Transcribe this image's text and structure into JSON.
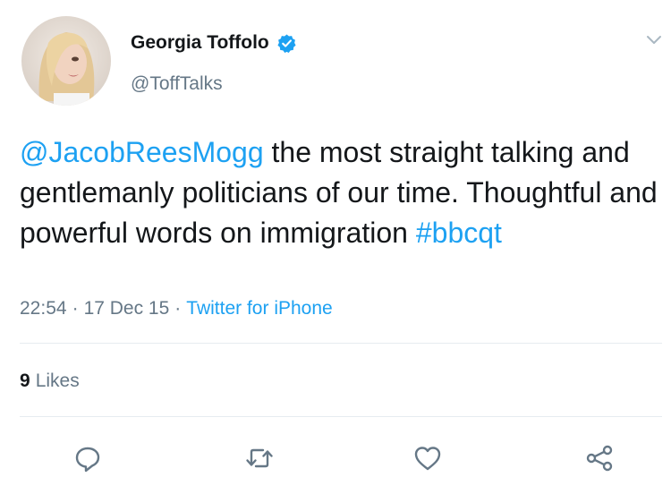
{
  "author": {
    "display_name": "Georgia Toffolo",
    "handle": "@ToffTalks",
    "verified": true
  },
  "tweet": {
    "mention": "@JacobReesMogg",
    "text": " the most straight talking and gentlemanly politicians of our time. Thoughtful and powerful words on immigration ",
    "hashtag": "#bbcqt"
  },
  "meta": {
    "time": "22:54",
    "separator": "·",
    "date": "17 Dec 15",
    "source": "Twitter for iPhone"
  },
  "engagement": {
    "likes_count": "9",
    "likes_label": "Likes"
  },
  "actions": {
    "reply_icon": "reply-icon",
    "retweet_icon": "retweet-icon",
    "like_icon": "heart-icon",
    "share_icon": "share-icon"
  },
  "colors": {
    "link": "#1da1f2",
    "text": "#14171a",
    "muted": "#657786",
    "divider": "#e6ecf0",
    "icon": "#657786"
  }
}
